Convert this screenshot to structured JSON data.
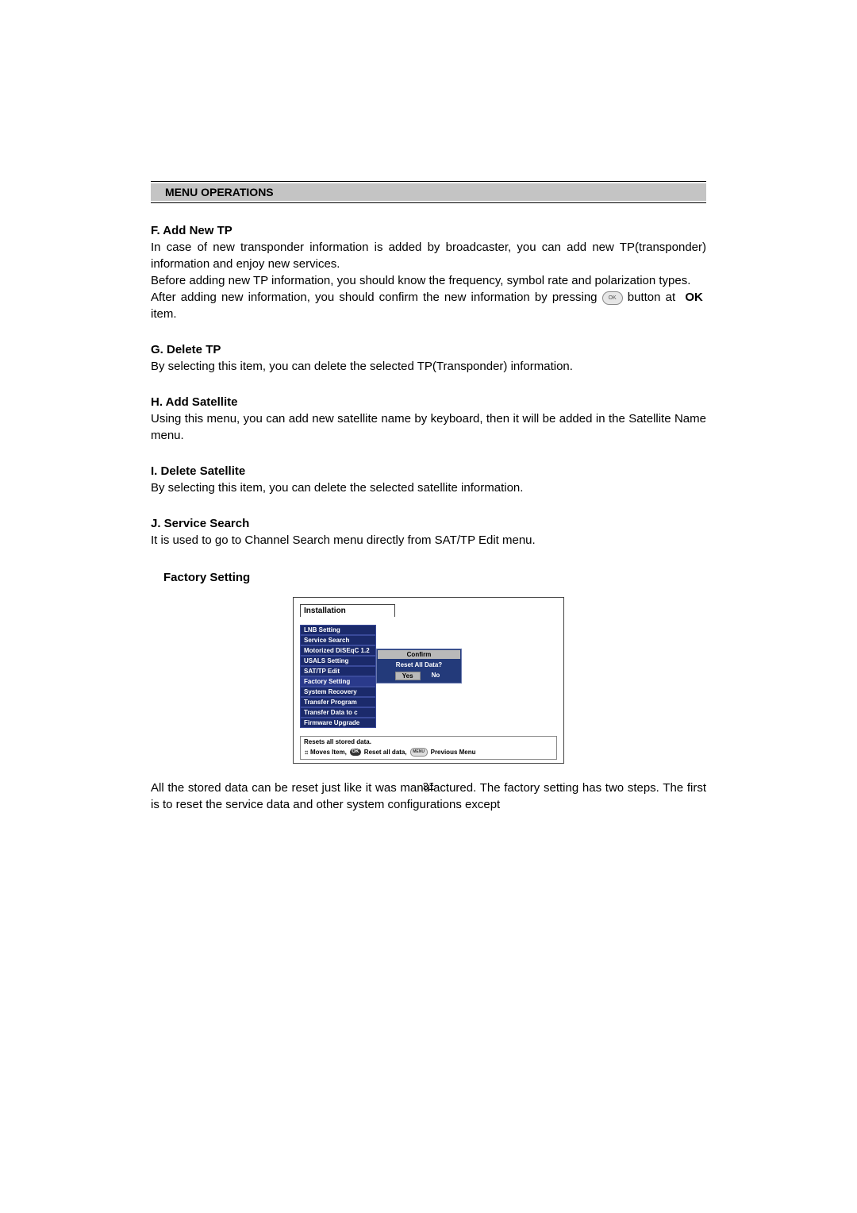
{
  "header": {
    "title": "MENU OPERATIONS"
  },
  "sections": {
    "f": {
      "heading": "F. Add New TP",
      "p1": "In case of new transponder information is added by broadcaster, you can add new TP(transponder) information and enjoy new services.",
      "p2": "Before adding new TP information, you should know the frequency, symbol rate and polarization types.",
      "p3a": "After adding new information, you should confirm the new information by pressing",
      "p3b": "button at",
      "ok_word": "OK",
      "p3c": "item.",
      "ok_button_glyph": "OK"
    },
    "g": {
      "heading": "G. Delete TP",
      "p1": "By selecting this item, you can delete the selected TP(Transponder) information."
    },
    "h": {
      "heading": "H. Add Satellite",
      "p1": "Using this menu, you can add new satellite name by keyboard, then it will be added in the Satellite Name menu."
    },
    "i": {
      "heading": "I. Delete Satellite",
      "p1": "By selecting this item, you can delete the selected satellite information."
    },
    "j": {
      "heading": "J. Service Search",
      "p1": "It is used to go to Channel Search menu directly from SAT/TP Edit menu."
    },
    "factory": {
      "heading": "Factory Setting"
    }
  },
  "screenshot": {
    "window_title": "Installation",
    "menu_items": [
      "LNB Setting",
      "Service Search",
      "Motorized DiSEqC 1.2",
      "USALS Setting",
      "SAT/TP Edit",
      "Factory Setting",
      "System Recovery",
      "Transfer Program",
      "Transfer Data to c",
      "Firmware Upgrade"
    ],
    "selected_index": 5,
    "dialog": {
      "title": "Confirm",
      "question": "Reset All Data?",
      "yes": "Yes",
      "no": "No"
    },
    "help": {
      "line1": "Resets all stored data.",
      "moves": "Moves Item,",
      "ok_label": "OK",
      "reset": "Reset all data,",
      "menu_label": "MENU",
      "prev": "Previous Menu"
    }
  },
  "footer_para": "All the stored data can be reset just like it was manufactured. The factory setting has two steps. The first is to reset the service data and other system configurations except",
  "page_number": "31"
}
